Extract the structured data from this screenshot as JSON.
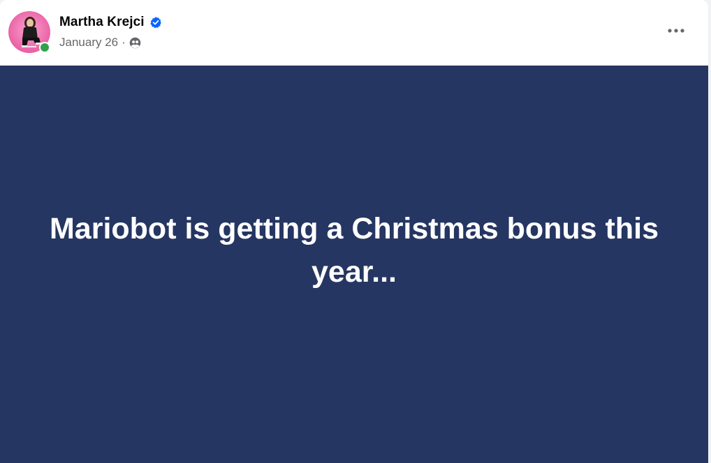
{
  "post": {
    "author": {
      "name": "Martha Krejci",
      "verified": true,
      "online": true,
      "avatar_icon": "profile-photo",
      "avatar_colors": [
        "#f06cb0",
        "#1a1a1a"
      ]
    },
    "date": "January 26",
    "separator": "·",
    "audience_icon": "public-globe-icon",
    "more_icon": "more-horizontal-icon",
    "body_text": "Mariobot is getting a Christmas bonus this year...",
    "body_background": "#253662",
    "body_text_color": "#ffffff"
  },
  "colors": {
    "verified_badge": "#0866ff",
    "online_dot": "#31a24c",
    "secondary_text": "#65676b",
    "primary_text": "#050505"
  }
}
